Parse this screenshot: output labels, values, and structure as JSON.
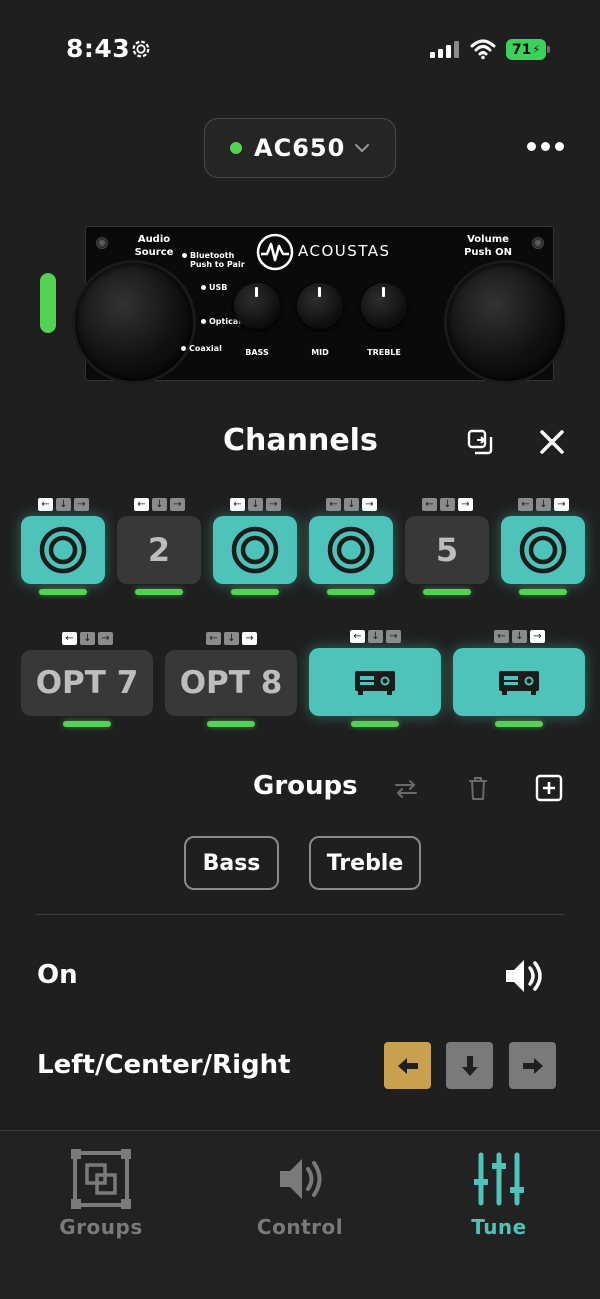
{
  "status_bar": {
    "time": "8:43",
    "battery": "71"
  },
  "header": {
    "device": "AC650"
  },
  "amp_panel": {
    "brand": "ACOUSTAS",
    "audio_source_label": "Audio\nSource",
    "volume_label": "Volume\nPush ON",
    "sources": [
      "Bluetooth\nPush to Pair",
      "USB",
      "Optical",
      "Coaxial"
    ],
    "knobs": [
      "BASS",
      "MID",
      "TREBLE"
    ]
  },
  "channels": {
    "title": "Channels",
    "tiles": [
      {
        "id": "ch1",
        "label": "",
        "icon": "speaker-icon",
        "state": "teal",
        "arrow": 0
      },
      {
        "id": "ch2",
        "label": "2",
        "icon": "",
        "state": "gray",
        "arrow": 0
      },
      {
        "id": "ch3",
        "label": "",
        "icon": "speaker-icon",
        "state": "teal",
        "arrow": 0
      },
      {
        "id": "ch4",
        "label": "",
        "icon": "speaker-icon",
        "state": "teal",
        "arrow": 2
      },
      {
        "id": "ch5",
        "label": "5",
        "icon": "",
        "state": "gray",
        "arrow": 2
      },
      {
        "id": "ch6",
        "label": "",
        "icon": "speaker-icon",
        "state": "teal",
        "arrow": 2
      },
      {
        "id": "opt7",
        "label": "OPT 7",
        "icon": "",
        "state": "gray",
        "arrow": 0
      },
      {
        "id": "opt8",
        "label": "OPT 8",
        "icon": "",
        "state": "gray",
        "arrow": 2
      },
      {
        "id": "rcv1",
        "label": "",
        "icon": "receiver-icon",
        "state": "teal",
        "arrow": 0
      },
      {
        "id": "rcv2",
        "label": "",
        "icon": "receiver-icon",
        "state": "teal",
        "arrow": 2
      }
    ]
  },
  "groups": {
    "title": "Groups",
    "chips": [
      "Bass",
      "Treble"
    ]
  },
  "settings": {
    "on_label": "On",
    "lcr_label": "Left/Center/Right",
    "lcr_selected": "left"
  },
  "tabbar": {
    "tabs": [
      {
        "label": "Groups",
        "icon": "groups-icon",
        "active": false
      },
      {
        "label": "Control",
        "icon": "speaker-volume-icon",
        "active": false
      },
      {
        "label": "Tune",
        "icon": "sliders-icon",
        "active": true
      }
    ]
  },
  "colors": {
    "accent": "#4ec3b9",
    "green": "#52d356",
    "gold": "#c9a04e"
  }
}
